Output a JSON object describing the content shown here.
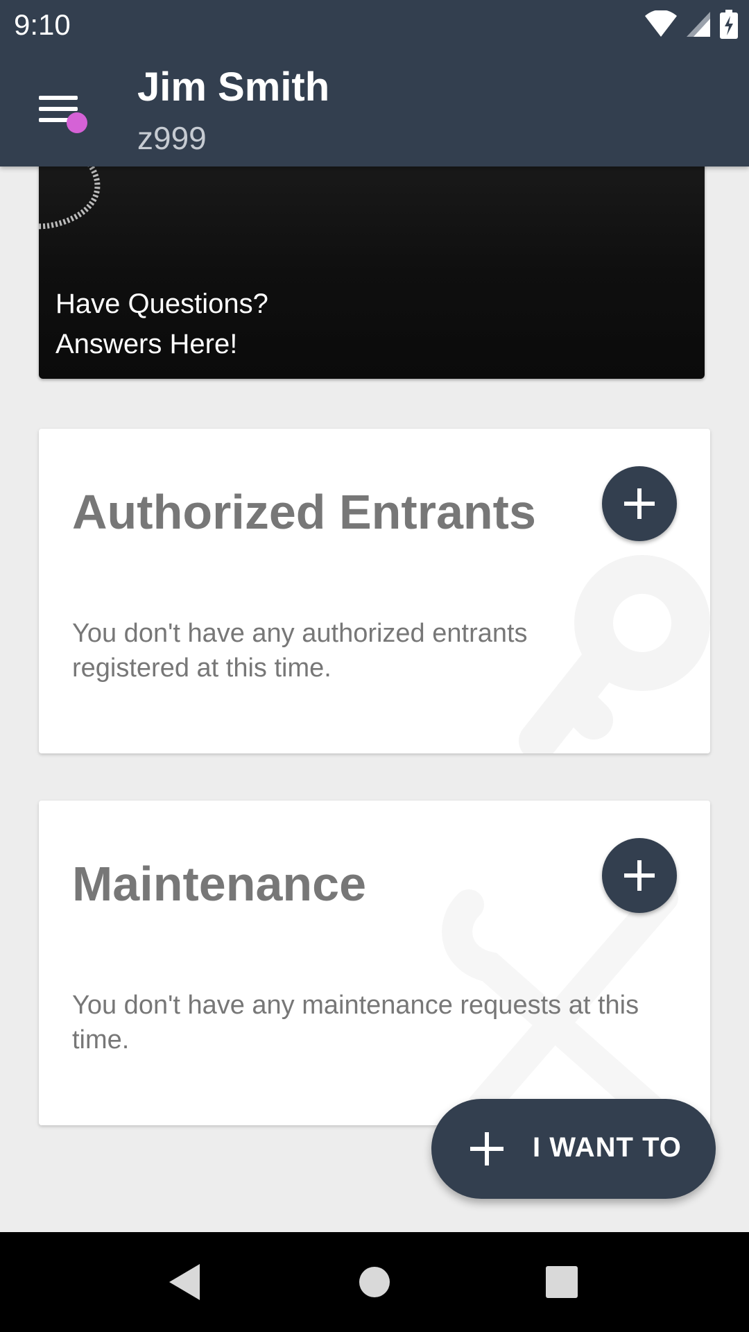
{
  "status_bar": {
    "time": "9:10"
  },
  "header": {
    "name": "Jim Smith",
    "user_id": "z999",
    "menu_badge_color": "#d562d6",
    "background_color": "#333f4f"
  },
  "hero": {
    "line1": "Have Questions?",
    "line2": "Answers Here!"
  },
  "cards": [
    {
      "title": "Authorized Entrants",
      "empty_text": "You don't have any authorized entrants registered at this time.",
      "add_icon": "plus-icon",
      "watermark_icon": "key-icon"
    },
    {
      "title": "Maintenance",
      "empty_text": "You don't have any maintenance requests at this time.",
      "add_icon": "plus-icon",
      "watermark_icon": "wrench-icon"
    }
  ],
  "fab": {
    "label": "I WANT TO",
    "icon": "plus-icon"
  },
  "nav": {
    "back_icon": "back-icon",
    "home_icon": "home-icon",
    "recents_icon": "recents-icon"
  }
}
